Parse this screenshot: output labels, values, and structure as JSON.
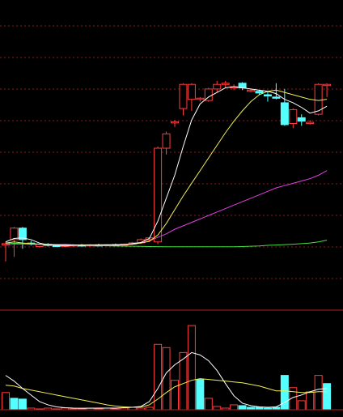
{
  "chart_data": [
    {
      "type": "candlestick",
      "panel": "price",
      "ylim": [
        0,
        100
      ],
      "grid": true,
      "up_color": "#ff3b3b",
      "down_color": "#54ffff",
      "ma_colors": {
        "ma5": "#ffffff",
        "ma10": "#f0f050",
        "ma20": "#e040e0",
        "ma60": "#40e040"
      },
      "candles": [
        {
          "o": 60,
          "h": 62,
          "l": 45,
          "c": 60.5
        },
        {
          "o": 64,
          "h": 75,
          "l": 49,
          "c": 74
        },
        {
          "o": 74,
          "h": 75,
          "l": 56,
          "c": 64
        },
        {
          "o": 61,
          "h": 63,
          "l": 59,
          "c": 60
        },
        {
          "o": 58,
          "h": 60,
          "l": 57,
          "c": 60
        },
        {
          "o": 60,
          "h": 61,
          "l": 58,
          "c": 59
        },
        {
          "o": 59,
          "h": 60,
          "l": 57.5,
          "c": 58.5
        },
        {
          "o": 58.5,
          "h": 59.5,
          "l": 58,
          "c": 59
        },
        {
          "o": 59,
          "h": 60,
          "l": 58.3,
          "c": 59.4
        },
        {
          "o": 59.4,
          "h": 60.2,
          "l": 58.5,
          "c": 59.2
        },
        {
          "o": 59.2,
          "h": 60,
          "l": 58.4,
          "c": 59.5
        },
        {
          "o": 59.5,
          "h": 60.4,
          "l": 58.7,
          "c": 59.3
        },
        {
          "o": 59.3,
          "h": 60.2,
          "l": 58.6,
          "c": 59.7
        },
        {
          "o": 59.7,
          "h": 60.6,
          "l": 59,
          "c": 59.5
        },
        {
          "o": 59.5,
          "h": 60.6,
          "l": 58.9,
          "c": 60.1
        },
        {
          "o": 60.1,
          "h": 62,
          "l": 59.4,
          "c": 61.2
        },
        {
          "o": 61.2,
          "h": 65,
          "l": 60.2,
          "c": 64
        },
        {
          "o": 64,
          "h": 66,
          "l": 62,
          "c": 65.5
        },
        {
          "o": 62,
          "h": 145,
          "l": 60,
          "c": 143.5
        },
        {
          "o": 143.5,
          "h": 158,
          "l": 138,
          "c": 156
        },
        {
          "o": 166,
          "h": 168,
          "l": 162,
          "c": 166.5
        },
        {
          "o": 178,
          "h": 200,
          "l": 172,
          "c": 199
        },
        {
          "o": 186,
          "h": 200,
          "l": 176,
          "c": 199
        },
        {
          "o": 186,
          "h": 188,
          "l": 184,
          "c": 187
        },
        {
          "o": 185,
          "h": 196,
          "l": 184,
          "c": 195
        },
        {
          "o": 195,
          "h": 202,
          "l": 192,
          "c": 199
        },
        {
          "o": 199,
          "h": 202,
          "l": 196,
          "c": 200
        },
        {
          "o": 197,
          "h": 199,
          "l": 194,
          "c": 197
        },
        {
          "o": 200,
          "h": 201,
          "l": 194,
          "c": 196
        },
        {
          "o": 194,
          "h": 195,
          "l": 192,
          "c": 194
        },
        {
          "o": 193,
          "h": 194,
          "l": 190,
          "c": 191.5
        },
        {
          "o": 190,
          "h": 193,
          "l": 184,
          "c": 189
        },
        {
          "o": 188,
          "h": 200,
          "l": 186,
          "c": 187.5
        },
        {
          "o": 183,
          "h": 195,
          "l": 163,
          "c": 164
        },
        {
          "o": 165,
          "h": 178,
          "l": 161,
          "c": 177
        },
        {
          "o": 170,
          "h": 173,
          "l": 163,
          "c": 167
        },
        {
          "o": 165,
          "h": 168,
          "l": 164,
          "c": 166
        },
        {
          "o": 173,
          "h": 200,
          "l": 172,
          "c": 199
        },
        {
          "o": 199,
          "h": 200,
          "l": 188,
          "c": 199
        }
      ],
      "ma5": [
        62,
        65,
        65.5,
        64,
        61,
        59.5,
        59.3,
        59.6,
        59.4,
        59.1,
        59.3,
        59.2,
        59.4,
        59.3,
        59.7,
        60.5,
        61.5,
        65,
        80,
        100,
        120,
        145,
        168,
        182,
        188,
        192,
        196,
        197,
        196,
        195,
        194,
        193,
        191,
        186,
        183,
        179,
        174,
        176,
        180
      ],
      "ma10": [
        61,
        62,
        61,
        60.5,
        60,
        59.5,
        59.2,
        58.5,
        59,
        59.4,
        59.3,
        59.4,
        59.3,
        59.5,
        59.6,
        60,
        61,
        62.5,
        68,
        78,
        90,
        102,
        113,
        124,
        135,
        146,
        157,
        167,
        176,
        184,
        190,
        193,
        194,
        192,
        190,
        188,
        186,
        185,
        186
      ],
      "ma20": [
        59.5,
        60,
        60,
        60,
        60,
        59.8,
        59.6,
        59.4,
        59.3,
        59.2,
        59.2,
        59.3,
        59.3,
        59.4,
        59.6,
        60,
        61,
        63,
        66,
        69,
        73,
        76,
        79,
        82,
        85,
        88,
        91,
        94,
        97,
        100,
        103,
        106,
        109,
        111,
        113,
        115,
        117,
        120,
        124
      ],
      "ma60": [
        61,
        60.8,
        60.6,
        60.4,
        60.2,
        60,
        59.8,
        59.6,
        59.4,
        59.2,
        59,
        58.8,
        58.6,
        58.4,
        58.3,
        58.2,
        58.1,
        58,
        57.9,
        57.8,
        57.8,
        57.8,
        57.8,
        57.8,
        57.8,
        57.8,
        57.8,
        57.8,
        58,
        58.2,
        58.5,
        59,
        59.3,
        59.6,
        60,
        60.5,
        61,
        62,
        63.5
      ]
    },
    {
      "type": "bar",
      "panel": "volume",
      "ylim": [
        0,
        110
      ],
      "values": [
        21,
        14,
        13,
        2,
        1,
        2,
        1,
        2,
        1,
        1,
        2,
        1,
        2,
        1,
        2,
        3,
        2,
        3,
        80,
        76,
        36,
        70,
        103,
        37,
        14,
        4,
        2,
        6,
        5,
        3,
        3,
        2,
        3,
        42,
        27,
        11,
        22,
        42,
        32
      ],
      "up": [
        true,
        false,
        false,
        true,
        true,
        true,
        true,
        true,
        true,
        true,
        true,
        true,
        true,
        true,
        true,
        true,
        true,
        true,
        true,
        true,
        true,
        true,
        true,
        false,
        true,
        true,
        true,
        true,
        false,
        false,
        false,
        false,
        false,
        false,
        true,
        true,
        true,
        true,
        false
      ],
      "ma5": [
        42,
        35,
        26,
        18,
        10,
        6,
        3.5,
        2.5,
        2,
        1.8,
        1.8,
        2,
        2,
        2,
        2.5,
        3,
        4,
        10,
        26,
        45,
        55,
        62,
        70,
        67,
        60,
        48,
        32,
        17,
        8,
        5,
        3.5,
        3,
        3.5,
        9,
        15,
        18,
        22,
        25,
        26
      ],
      "ma10": [
        30,
        29,
        26,
        24,
        22,
        20,
        18,
        16,
        14,
        12,
        10,
        8,
        6,
        4.5,
        3.5,
        3,
        3.2,
        6,
        13,
        21,
        28,
        32,
        36,
        38,
        37,
        36,
        35,
        34,
        33,
        31,
        29,
        26,
        23,
        23,
        22,
        21,
        21,
        22,
        22
      ]
    }
  ]
}
